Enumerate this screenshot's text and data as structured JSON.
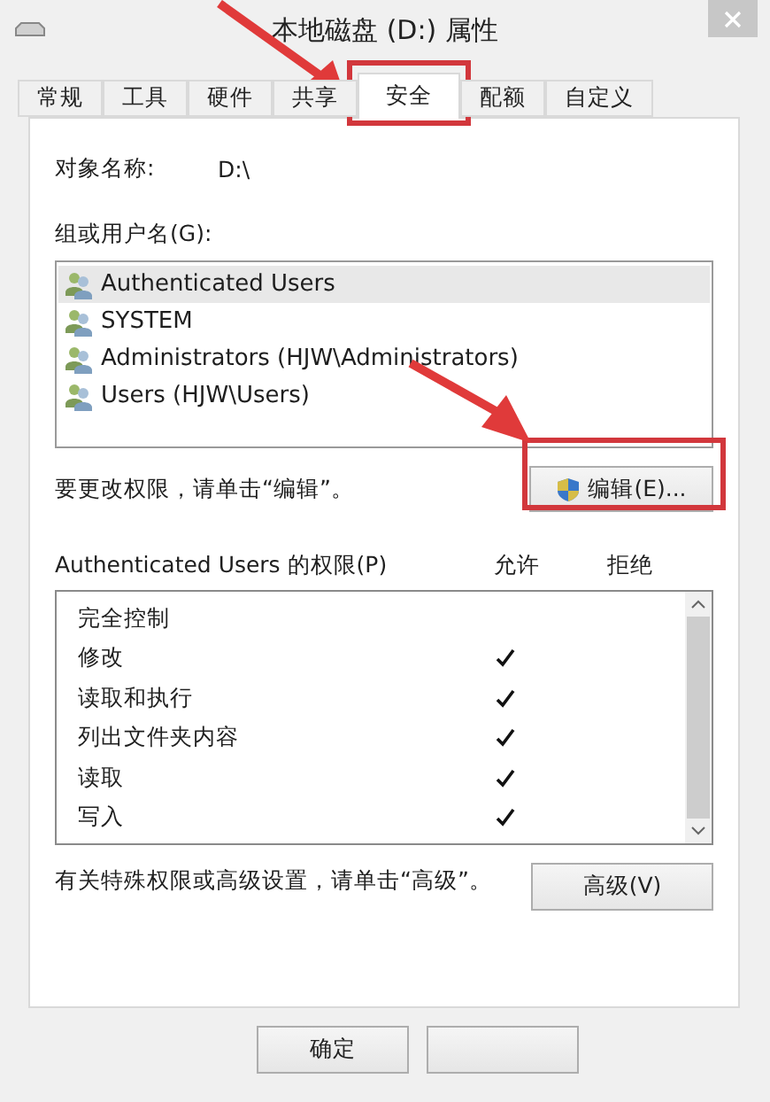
{
  "window": {
    "title": "本地磁盘 (D:) 属性"
  },
  "tabs": [
    {
      "label": "常规",
      "selected": false
    },
    {
      "label": "工具",
      "selected": false
    },
    {
      "label": "硬件",
      "selected": false
    },
    {
      "label": "共享",
      "selected": false
    },
    {
      "label": "安全",
      "selected": true
    },
    {
      "label": "配额",
      "selected": false
    },
    {
      "label": "自定义",
      "selected": false
    }
  ],
  "object_name": {
    "label": "对象名称:",
    "value": "D:\\"
  },
  "groups": {
    "label": "组或用户名(G):",
    "items": [
      {
        "name": "Authenticated Users",
        "selected": true
      },
      {
        "name": "SYSTEM",
        "selected": false
      },
      {
        "name": "Administrators (HJW\\Administrators)",
        "selected": false
      },
      {
        "name": "Users (HJW\\Users)",
        "selected": false
      }
    ]
  },
  "edit_hint": "要更改权限，请单击“编辑”。",
  "edit_button": "编辑(E)...",
  "permissions": {
    "title": "Authenticated Users 的权限(P)",
    "allow_header": "允许",
    "deny_header": "拒绝",
    "rows": [
      {
        "name": "完全控制",
        "allow": false
      },
      {
        "name": "修改",
        "allow": true
      },
      {
        "name": "读取和执行",
        "allow": true
      },
      {
        "name": "列出文件夹内容",
        "allow": true
      },
      {
        "name": "读取",
        "allow": true
      },
      {
        "name": "写入",
        "allow": true
      }
    ]
  },
  "advanced_hint": "有关特殊权限或高级设置，请单击“高级”。",
  "advanced_button": "高级(V)",
  "buttons": [
    "确定"
  ]
}
